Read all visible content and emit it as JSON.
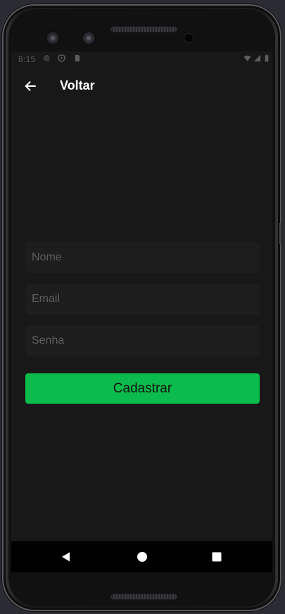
{
  "statusbar": {
    "time": "8:15",
    "icons": [
      "gear-icon",
      "shield-icon",
      "sim-card-icon",
      "wifi-icon",
      "signal-icon",
      "battery-icon"
    ]
  },
  "appbar": {
    "back_icon": "arrow-left-icon",
    "title": "Voltar"
  },
  "form": {
    "name_placeholder": "Nome",
    "email_placeholder": "Email",
    "password_placeholder": "Senha",
    "submit_label": "Cadastrar"
  },
  "navbar": {
    "icons": [
      "nav-back-icon",
      "nav-home-icon",
      "nav-recents-icon"
    ]
  },
  "colors": {
    "background": "#181818",
    "field_background": "#1d1d1d",
    "accent": "#0bbb4b",
    "navbar": "#000000"
  }
}
